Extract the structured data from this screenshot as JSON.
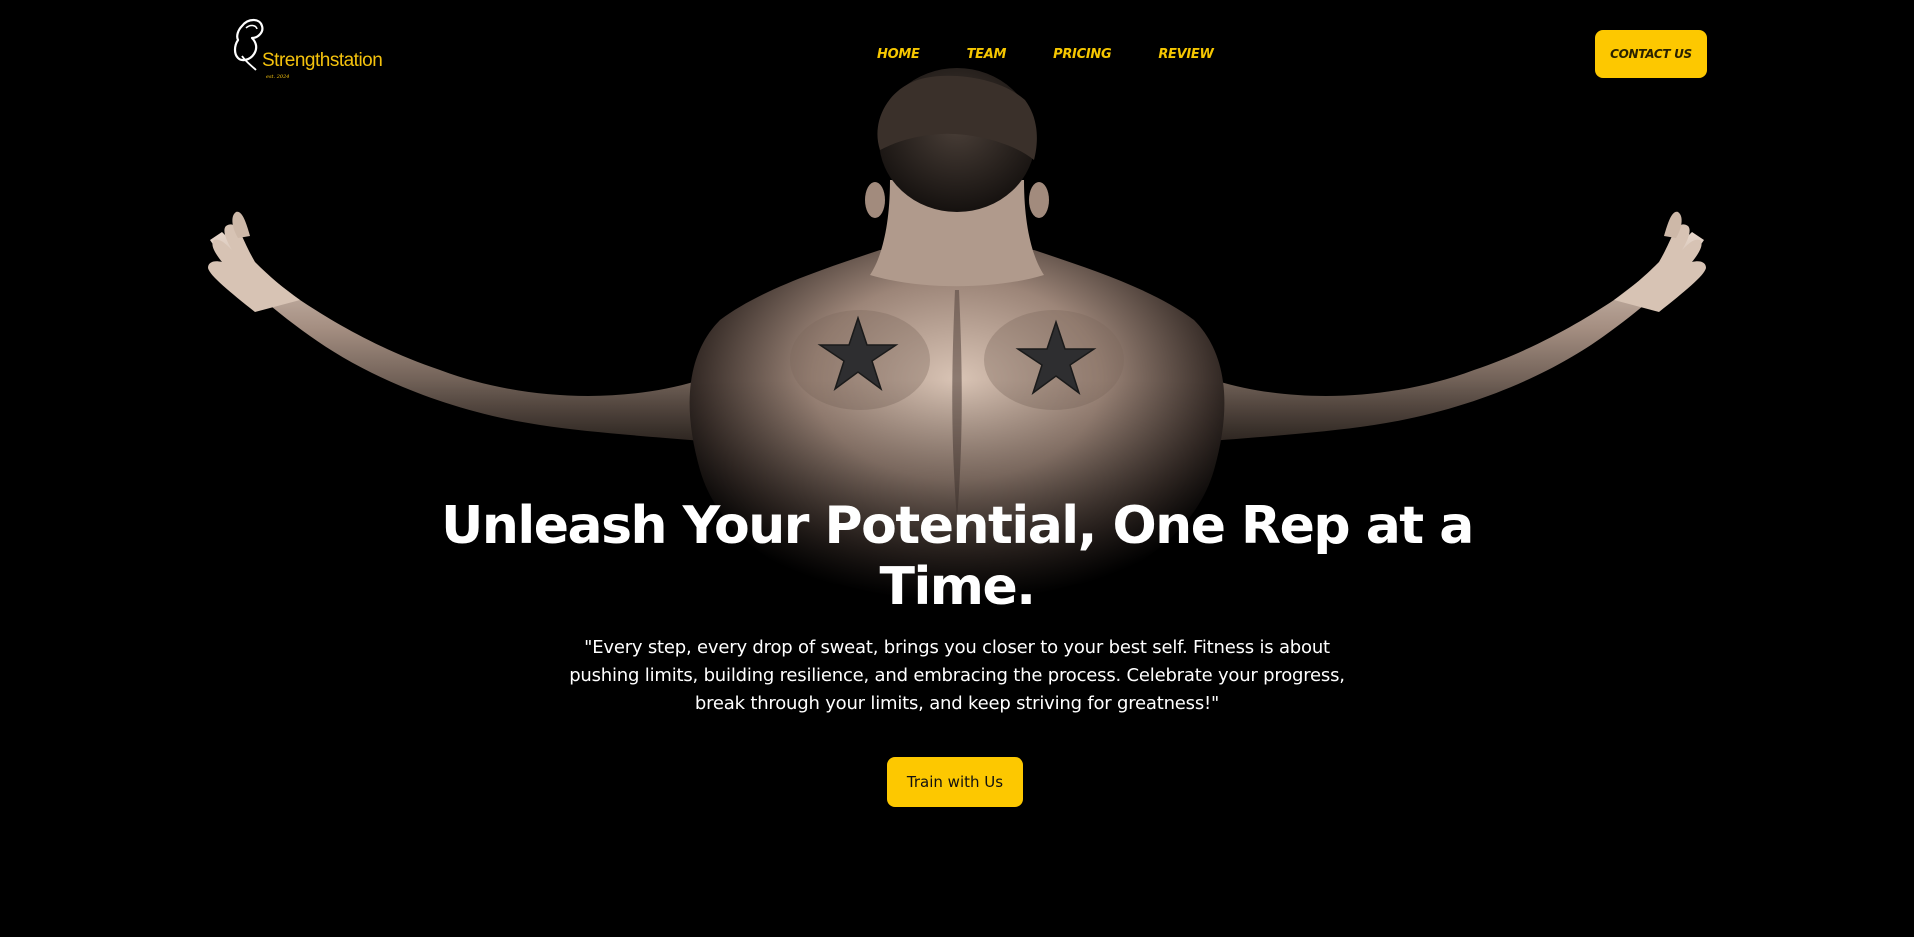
{
  "brand": {
    "name": "Strengthstation",
    "tagline": "est. 2024",
    "logo_icon": "flexed-arm-icon",
    "accent_color": "#fdc800"
  },
  "nav": {
    "items": [
      {
        "label": "Home"
      },
      {
        "label": "Team"
      },
      {
        "label": "Pricing"
      },
      {
        "label": "Review"
      }
    ]
  },
  "header": {
    "contact_label": "Contact Us"
  },
  "hero": {
    "title": "Unleash Your Potential, One Rep at a Time.",
    "quote": "\"Every step, every drop of sweat, brings you closer to your best self. Fitness is about pushing limits, building resilience, and embracing the process. Celebrate your progress, break through your limits, and keep striving for greatness!\"",
    "cta_label": "Train with Us",
    "background_image": "muscular-back-arms-outstretched-photo",
    "background_color": "#000000",
    "text_color": "#ffffff"
  }
}
